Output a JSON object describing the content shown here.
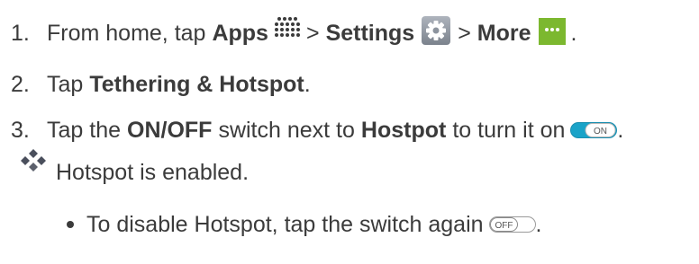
{
  "steps": [
    {
      "number": "1.",
      "text_before": "From home, tap",
      "apps_label": "Apps",
      "sep1": ">",
      "settings_label": "Settings",
      "sep2": ">",
      "more_label": "More",
      "end": "."
    },
    {
      "number": "2.",
      "text_before": "Tap",
      "bold": "Tethering & Hotspot",
      "end": "."
    },
    {
      "number": "3.",
      "text_before": "Tap the",
      "bold1": "ON/OFF",
      "text_mid": "switch next to",
      "bold2": "Hostpot",
      "text_after": "to turn it on",
      "toggle_label": "ON",
      "end": "."
    }
  ],
  "result": {
    "text": "Hotspot is enabled."
  },
  "sub_bullet": {
    "text": "To disable Hotspot, tap the switch again",
    "toggle_label": "OFF",
    "end": "."
  },
  "colors": {
    "text": "#3b3b3b",
    "toggle_on": "#1aa3c8",
    "more_icon_bg": "#7cb82f",
    "diamond_icon": "#4a4f5c"
  },
  "icons": {
    "apps": "apps-grid-icon",
    "settings": "gear-icon",
    "more": "more-dots-icon",
    "result": "diamond-result-icon"
  }
}
